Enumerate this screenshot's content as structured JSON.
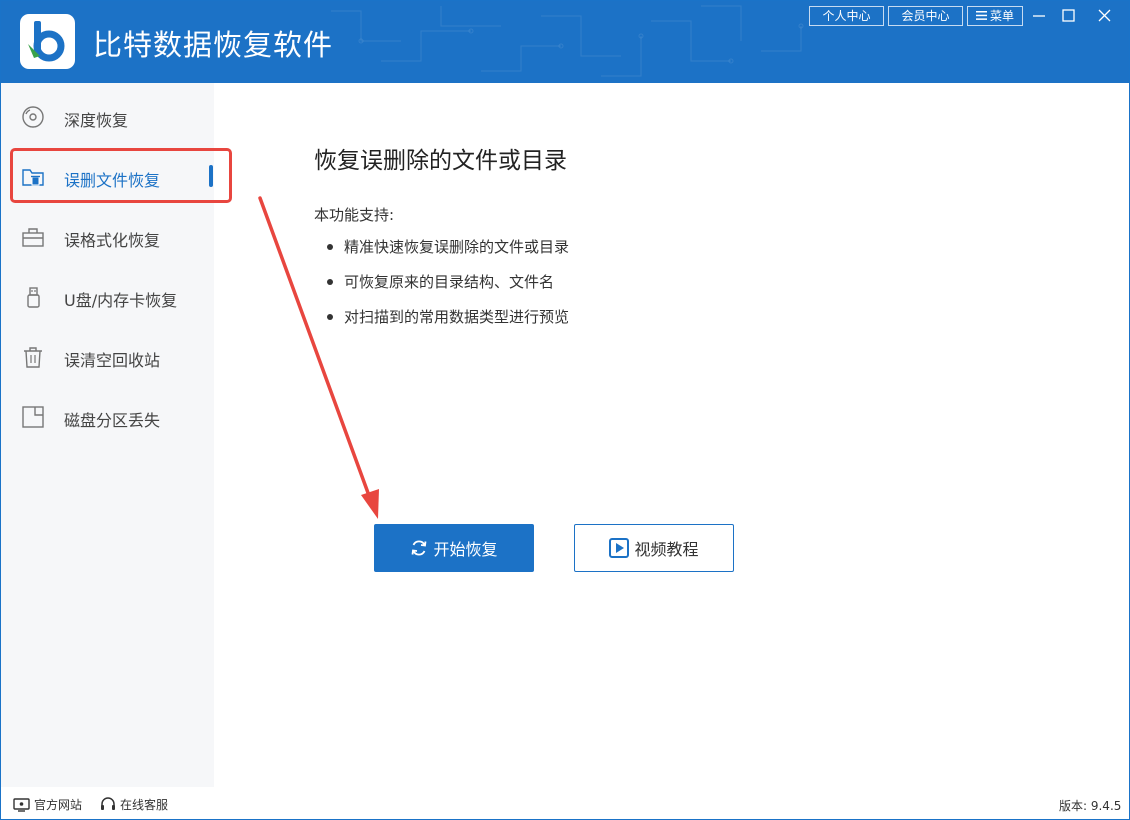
{
  "app": {
    "title": "比特数据恢复软件",
    "logo_letter": "b"
  },
  "header": {
    "user_center": "个人中心",
    "member_center": "会员中心",
    "menu": "菜单",
    "icons": [
      "minimize-icon",
      "maximize-icon",
      "close-icon"
    ]
  },
  "sidebar": {
    "items": [
      {
        "label": "深度恢复",
        "icon": "disc-icon"
      },
      {
        "label": "误删文件恢复",
        "icon": "folder-trash-icon",
        "active": true
      },
      {
        "label": "误格式化恢复",
        "icon": "toolbox-icon"
      },
      {
        "label": "U盘/内存卡恢复",
        "icon": "usb-drive-icon"
      },
      {
        "label": "误清空回收站",
        "icon": "trash-icon"
      },
      {
        "label": "磁盘分区丢失",
        "icon": "disk-partition-icon"
      }
    ]
  },
  "main": {
    "title": "恢复误删除的文件或目录",
    "support_label": "本功能支持:",
    "features": [
      "精准快速恢复误删除的文件或目录",
      "可恢复原来的目录结构、文件名",
      "对扫描到的常用数据类型进行预览"
    ],
    "start_button": "开始恢复",
    "video_button": "视频教程"
  },
  "footer": {
    "official_site": "官方网站",
    "online_service": "在线客服",
    "version": "版本: 9.4.5"
  },
  "colors": {
    "brand_blue": "#1c72c6",
    "annotation_red": "#e8463f",
    "sidebar_bg": "#f6f7f9"
  }
}
